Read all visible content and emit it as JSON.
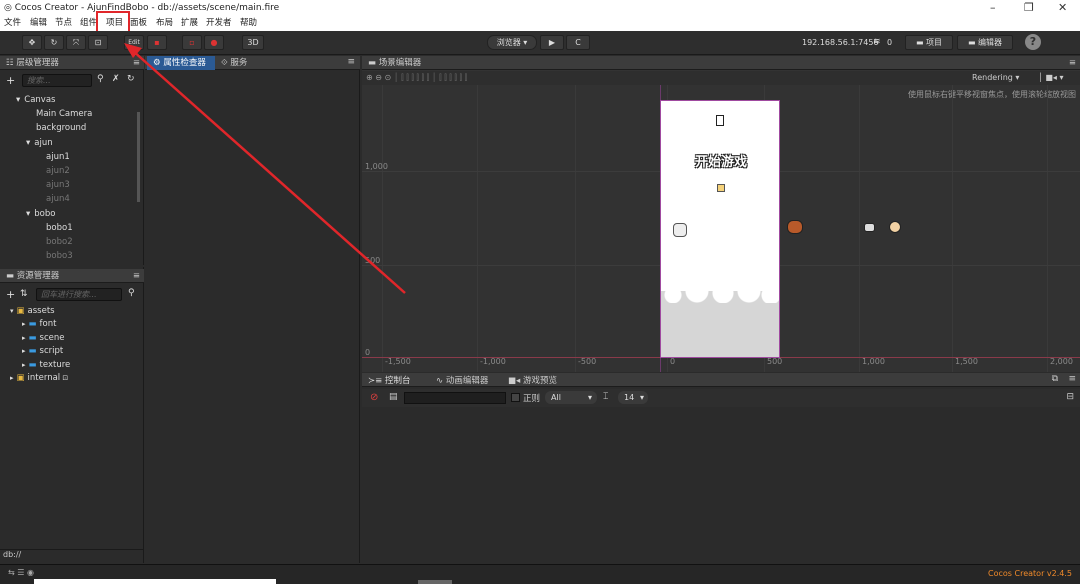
{
  "window": {
    "title": "Cocos Creator - AjunFindBobo - db://assets/scene/main.fire",
    "minimize": "–",
    "maximize": "❐",
    "close": "✕"
  },
  "menu": [
    "文件",
    "编辑",
    "节点",
    "组件",
    "项目",
    "面板",
    "布局",
    "扩展",
    "开发者",
    "帮助"
  ],
  "toolbar": {
    "tool_icons": [
      "✥",
      "↻",
      "⤧",
      "⊡"
    ],
    "edit_label": "Edit",
    "mode_3d": "3D",
    "preview_dropdown": "浏览器 ▾",
    "play": "▶",
    "refresh": "C",
    "ip": "192.168.56.1:7456",
    "wifi_icon": "wifi-icon",
    "wifi_count": "0",
    "project_btn": "项目",
    "editor_btn": "编辑器",
    "help": "?"
  },
  "hierarchy": {
    "title": "层级管理器",
    "search_placeholder": "搜索...",
    "nodes": [
      {
        "label": "Canvas",
        "depth": 0,
        "arrow": "▾",
        "dim": false
      },
      {
        "label": "Main Camera",
        "depth": 1,
        "arrow": "",
        "dim": false
      },
      {
        "label": "background",
        "depth": 1,
        "arrow": "",
        "dim": false
      },
      {
        "label": "ajun",
        "depth": 1,
        "arrow": "▾",
        "dim": false
      },
      {
        "label": "ajun1",
        "depth": 2,
        "arrow": "",
        "dim": false
      },
      {
        "label": "ajun2",
        "depth": 2,
        "arrow": "",
        "dim": true
      },
      {
        "label": "ajun3",
        "depth": 2,
        "arrow": "",
        "dim": true
      },
      {
        "label": "ajun4",
        "depth": 2,
        "arrow": "",
        "dim": true
      },
      {
        "label": "bobo",
        "depth": 1,
        "arrow": "▾",
        "dim": false
      },
      {
        "label": "bobo1",
        "depth": 2,
        "arrow": "",
        "dim": false
      },
      {
        "label": "bobo2",
        "depth": 2,
        "arrow": "",
        "dim": true
      },
      {
        "label": "bobo3",
        "depth": 2,
        "arrow": "",
        "dim": true
      }
    ]
  },
  "assets": {
    "title": "资源管理器",
    "search_placeholder": "回车进行搜索...",
    "items": [
      {
        "label": "assets",
        "depth": 0,
        "arrow": "▾"
      },
      {
        "label": "font",
        "depth": 1,
        "arrow": "▸"
      },
      {
        "label": "scene",
        "depth": 1,
        "arrow": "▸"
      },
      {
        "label": "script",
        "depth": 1,
        "arrow": "▸"
      },
      {
        "label": "texture",
        "depth": 1,
        "arrow": "▸"
      },
      {
        "label": "internal",
        "depth": 0,
        "arrow": "▸"
      }
    ],
    "path": "db://"
  },
  "inspector": {
    "tab1": "属性检查器",
    "tab2": "服务"
  },
  "scene": {
    "title": "场景编辑器",
    "rendering": "Rendering ▾",
    "hint": "使用鼠标右键平移视窗焦点，使用滚轮缩放视图",
    "x_labels": [
      "-1,500",
      "-1,000",
      "-500",
      "0",
      "500",
      "1,000",
      "1,500",
      "2,000"
    ],
    "y_labels": [
      "1,000",
      "500",
      "0"
    ],
    "game_title": "开始游戏"
  },
  "console": {
    "tabs": [
      "控制台",
      "动画编辑器",
      "游戏预览"
    ],
    "regex_label": "正则",
    "filter": "All",
    "font_size": "14"
  },
  "status": {
    "version": "Cocos Creator v2.4.5"
  }
}
